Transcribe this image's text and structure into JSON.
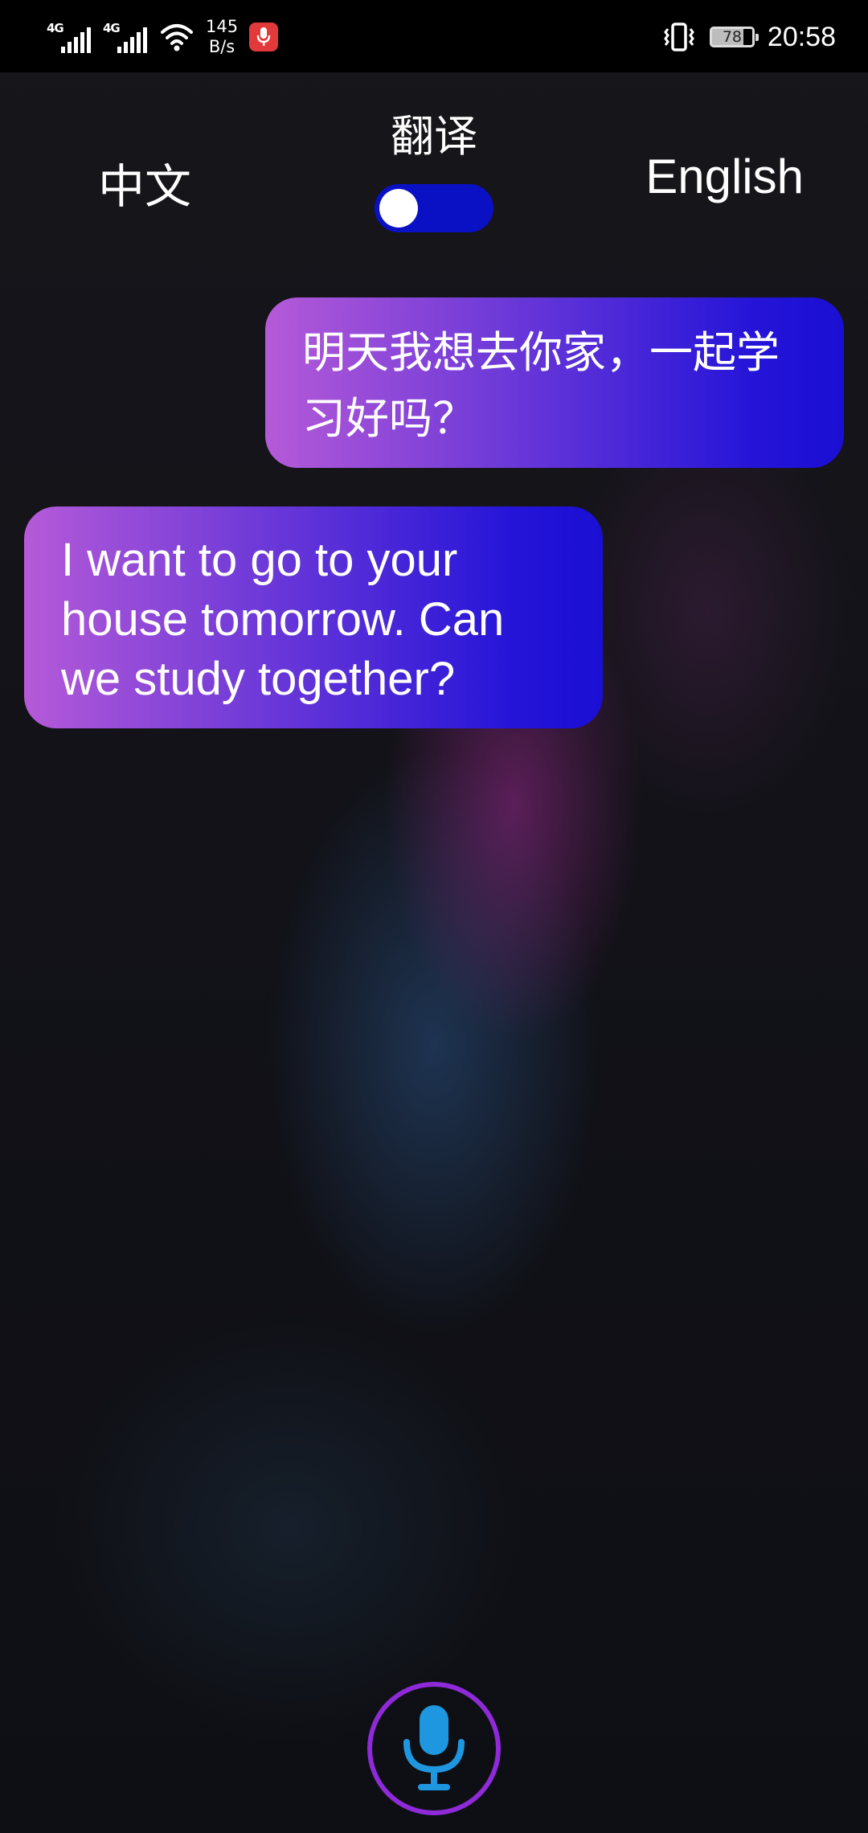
{
  "status_bar": {
    "network_1": "4G",
    "network_2": "4G",
    "speed_value": "145",
    "speed_unit": "B/s",
    "battery": "78",
    "time": "20:58",
    "icons": [
      "signal-icon",
      "wifi-icon",
      "mic-recording-icon",
      "vibrate-icon",
      "battery-icon"
    ]
  },
  "header": {
    "title": "翻译",
    "source_language": "中文",
    "target_language": "English",
    "toggle_on": true
  },
  "messages": [
    {
      "side": "right",
      "text": "明天我想去你家，一起学习好吗？"
    },
    {
      "side": "left",
      "text": "I want to go to your house tomorrow. Can we study together?"
    }
  ],
  "colors": {
    "bubble_gradient_start": "#b55ad8",
    "bubble_gradient_end": "#1a0fd3",
    "toggle_track": "#0a10c4",
    "mic_ring": "#8e2ad8",
    "mic_icon": "#1e97e0"
  }
}
